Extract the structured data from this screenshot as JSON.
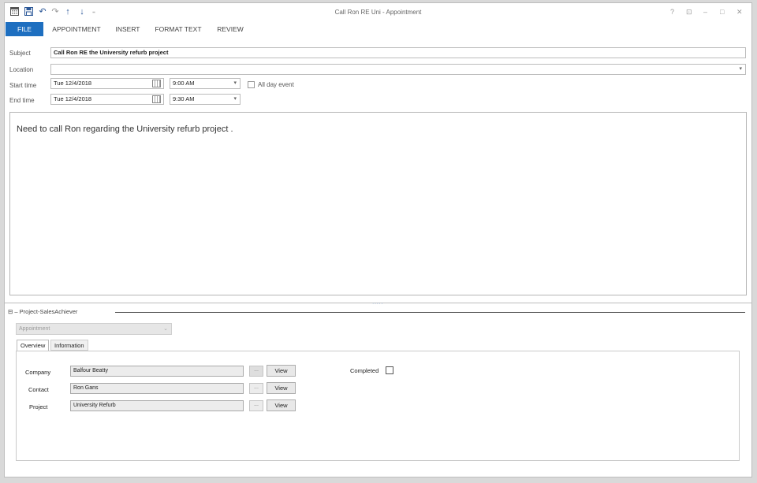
{
  "window": {
    "title": "Call Ron RE Uni - Appointment",
    "controls": {
      "help": "?",
      "restore_ribbon": "⊡",
      "minimize": "–",
      "maximize": "□",
      "close": "✕"
    }
  },
  "quick_access": [
    "calendar-icon",
    "save-icon",
    "undo-icon",
    "redo-icon",
    "up-arrow-icon",
    "down-arrow-icon",
    "customize-icon"
  ],
  "ribbon": {
    "tabs": [
      "FILE",
      "APPOINTMENT",
      "INSERT",
      "FORMAT TEXT",
      "REVIEW"
    ],
    "active_color": "#1e6fc0"
  },
  "form": {
    "subject_label": "Subject",
    "subject_value": "Call Ron RE  the University refurb project",
    "location_label": "Location",
    "location_value": "",
    "start_label": "Start time",
    "start_date": "Tue 12/4/2018",
    "start_time": "9:00 AM",
    "all_day_label": "All day event",
    "all_day_checked": false,
    "end_label": "End time",
    "end_date": "Tue 12/4/2018",
    "end_time": "9:30 AM"
  },
  "body_text": "Need to call Ron regarding the University refurb project .",
  "splitter_grip": "·····",
  "addin": {
    "collapse_glyph": "⊟",
    "title": "– Project-SalesAchiever",
    "type_value": "Appointment",
    "tabs": [
      "Overview",
      "Information"
    ],
    "company_label": "Company",
    "company_value": "Balfour Beatty",
    "contact_label": "Contact",
    "contact_value": "Ron Gans",
    "project_label": "Project",
    "project_value": "University Refurb",
    "dots_label": "...",
    "view_label": "View",
    "completed_label": "Completed",
    "completed_checked": false
  }
}
